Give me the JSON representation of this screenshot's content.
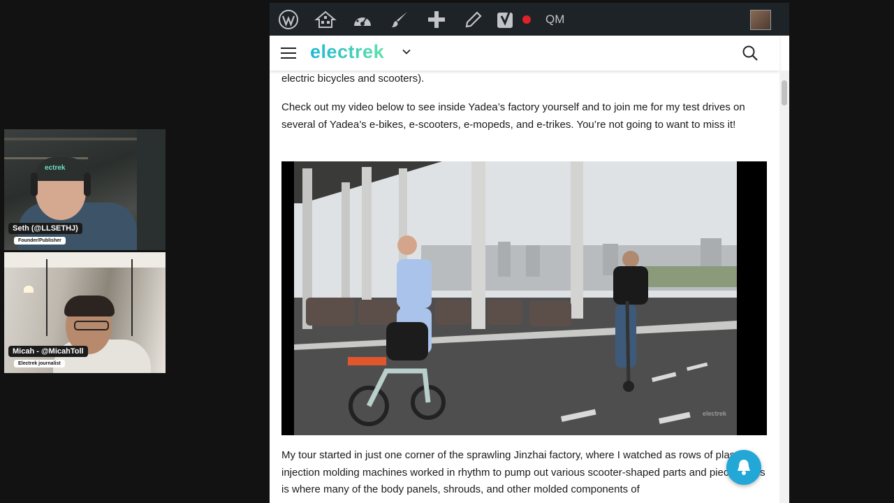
{
  "participants": [
    {
      "name": "Seth (@LLSETHJ)",
      "role": "Founder/Publisher",
      "cap_text": "ectrek"
    },
    {
      "name": "Micah - @MicahToll",
      "role": "Electrek journalist"
    }
  ],
  "admin_bar": {
    "icons": [
      "wordpress-icon",
      "home-network-icon",
      "dashboard-icon",
      "brush-icon",
      "plus-icon",
      "pencil-icon",
      "yoast-icon",
      "recording-dot-icon"
    ],
    "qm_label": "QM"
  },
  "site": {
    "logo": "electrek"
  },
  "article": {
    "p1": "electric bicycles and scooters).",
    "p2": "Check out my video below to see inside Yadea’s factory yourself and to join me for my test drives on several of Yadea’s e-bikes, e-scooters, e-mopeds, and e-trikes. You’re not going to want to miss it!",
    "video_watermark": "electrek",
    "p3": "My tour started in just one corner of the sprawling Jinzhai factory, where I watched as rows of plastic injection molding machines worked in rhythm to pump out various scooter-shaped parts and pieces. This is where many of the body panels, shrouds, and other molded components of"
  },
  "colors": {
    "admin_bar": "#1d2327",
    "brand_gradient_start": "#1fb7d3",
    "brand_gradient_end": "#5ee0a8",
    "notification_bell": "#22a7d6"
  }
}
